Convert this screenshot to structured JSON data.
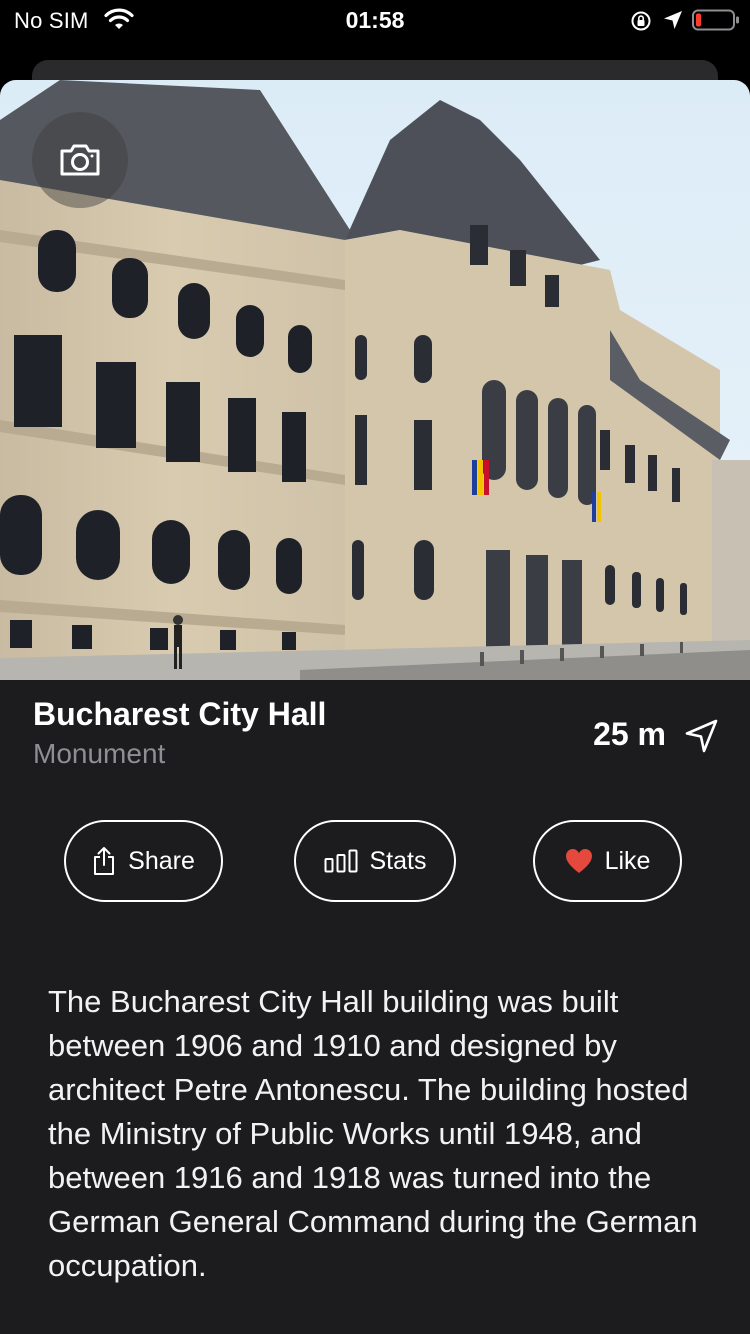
{
  "status_bar": {
    "carrier": "No SIM",
    "time": "01:58"
  },
  "place": {
    "name": "Bucharest City Hall",
    "category": "Monument",
    "distance": "25 m",
    "description": "The Bucharest City Hall building was built between 1906 and 1910 and designed by architect Petre Antonescu. The building hosted the Ministry of Public Works until 1948, and between 1916 and 1918 was turned into the German General Command during the German occupation."
  },
  "actions": {
    "share_label": "Share",
    "stats_label": "Stats",
    "like_label": "Like"
  },
  "icons": {
    "wifi": "wifi-icon",
    "orientation_lock": "orientation-lock-icon",
    "location": "location-arrow-icon",
    "battery": "battery-low-icon",
    "camera": "camera-icon",
    "navigate": "navigate-arrow-icon",
    "share": "share-icon",
    "stats": "bar-chart-icon",
    "like": "heart-icon"
  },
  "colors": {
    "background": "#000000",
    "card": "#1c1c1e",
    "secondary_text": "#8e8e93",
    "heart": "#e5483c",
    "battery_low": "#ff3b30"
  }
}
